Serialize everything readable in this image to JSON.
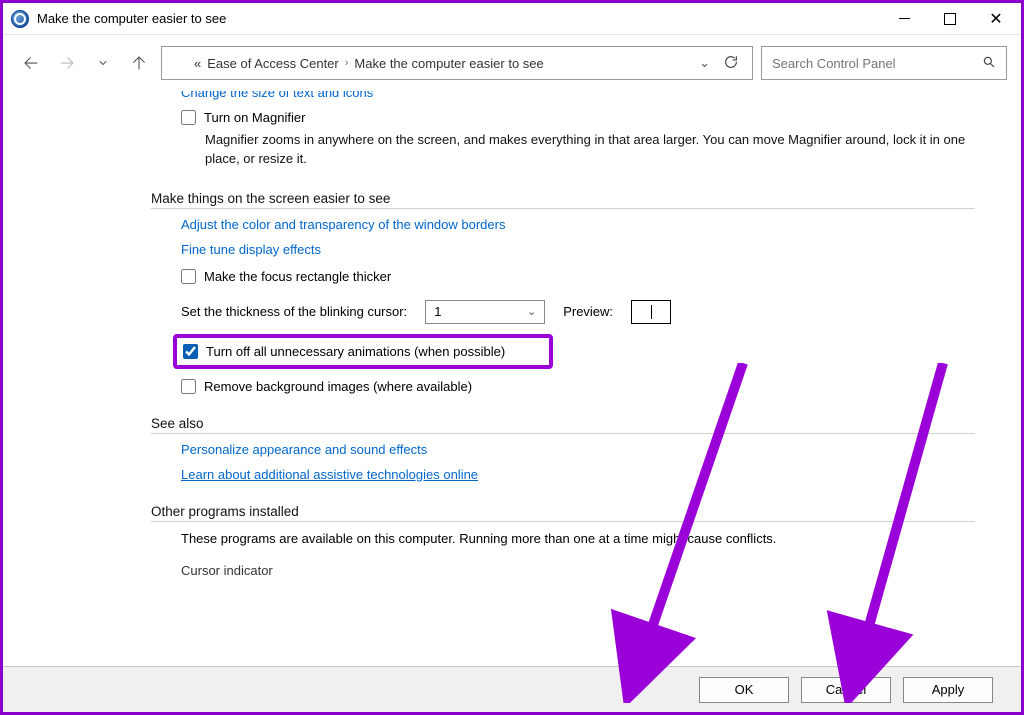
{
  "window": {
    "title": "Make the computer easier to see"
  },
  "breadcrumb": {
    "prefix": "«",
    "part1": "Ease of Access Center",
    "part2": "Make the computer easier to see"
  },
  "search": {
    "placeholder": "Search Control Panel"
  },
  "cut_link": "Change the size of text and icons",
  "magnifier": {
    "label": "Turn on Magnifier",
    "desc": "Magnifier zooms in anywhere on the screen, and makes everything in that area larger. You can move Magnifier around, lock it in one place, or resize it."
  },
  "section1": {
    "heading": "Make things on the screen easier to see",
    "link_color": "Adjust the color and transparency of the window borders",
    "link_fine": "Fine tune display effects",
    "focus_label": "Make the focus rectangle thicker",
    "cursor_label": "Set the thickness of the blinking cursor:",
    "cursor_value": "1",
    "preview_label": "Preview:",
    "turn_off_anim": "Turn off all unnecessary animations (when possible)",
    "remove_bg": "Remove background images (where available)"
  },
  "see_also": {
    "heading": "See also",
    "link_personalize": "Personalize appearance and sound effects",
    "link_learn": "Learn about additional assistive technologies online"
  },
  "other": {
    "heading": "Other programs installed",
    "desc": "These programs are available on this computer. Running more than one at a time might cause conflicts.",
    "cursor_ind": "Cursor indicator"
  },
  "footer": {
    "ok": "OK",
    "cancel": "Cancel",
    "apply": "Apply"
  },
  "checked": {
    "magnifier": false,
    "focus": false,
    "turn_off_anim": true,
    "remove_bg": false
  }
}
